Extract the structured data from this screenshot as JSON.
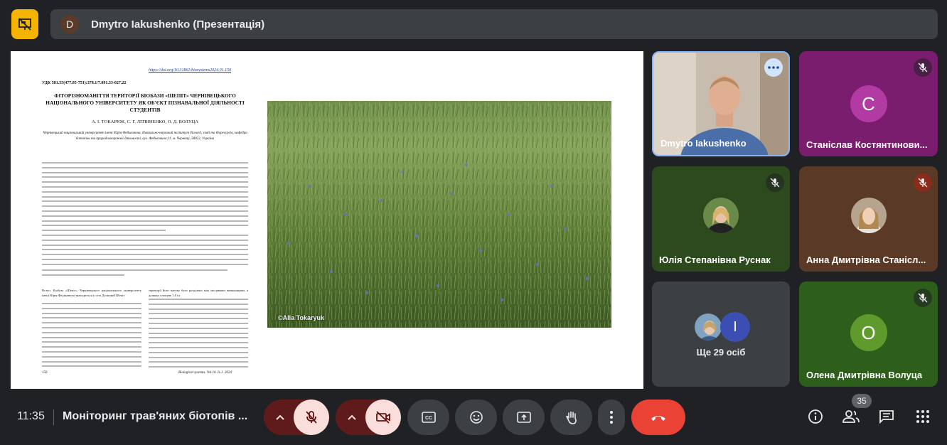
{
  "presenter": {
    "avatar_letter": "D",
    "title": "Dmytro Iakushenko (Презентація)"
  },
  "slide": {
    "doi": "https://doi.org/10.31861/biosystems2024.01.150",
    "udk": "УДК 581.55(477.85-751):378.1/7.091.33-027.22",
    "heading": "ФІТОРІЗНОМАНІТТЯ ТЕРИТОРІЇ БІОБАЗИ «ШЕПІТ» ЧЕРНІВЕЦЬКОГО НАЦІОНАЛЬНОГО УНІВЕРСИТЕТУ ЯК ОБ'ЄКТ ПІЗНАВАЛЬНОЇ ДІЯЛЬНОСТІ СТУДЕНТІВ",
    "authors": "А. І. ТОКАРЮК, С. Г. ЛІТВІНЕНКО, О. Д. ВОЛУЦА",
    "affiliation": "Чернівецький національний університет імені Юрія Федьковича, Навчально-науковий інститут біології, хімії та біоресурсів, кафедра ботаніки та природоохоронної діяльності, вул. Федьковича,11, м. Чернівці, 58022, Україна",
    "col1_start": "Вступ. Біобаза «Шепіт» Чернівецького національного університету імені Юрія Федьковича знаходиться у селі Долішній Шепіт",
    "col2_start": "території його маєтку було розділено між місцевими мешканцями, а ділянку площею 1,0 га",
    "footer_page": "150",
    "footer_journal": "Biological systems. Vol.16. Is.1. 2024",
    "photo_credit": "©Alla Tokaryuk"
  },
  "participants": [
    {
      "name": "Dmytro Iakushenko",
      "type": "video"
    },
    {
      "name": "Станіслав Костянтинови...",
      "letter": "C",
      "bg": "#7b1d6e",
      "avatar_color": "#b13aa3",
      "muted": true
    },
    {
      "name": "Юлія Степанівна Руснак",
      "bg": "#2d4a1e",
      "muted": true
    },
    {
      "name": "Анна Дмитрівна Станісл...",
      "bg": "#5a3a26",
      "muted": true
    },
    {
      "name": "Ще 29 осіб",
      "second_letter": "I",
      "avatar_color": "#3b4fb2"
    },
    {
      "name": "Олена Дмитрівна Волуца",
      "letter": "O",
      "bg": "#2e5e1c",
      "avatar_color": "#5f9a2c",
      "muted": true
    }
  ],
  "bottombar": {
    "time": "11:35",
    "meeting_title": "Моніторинг трав'яних біотопів ...",
    "people_count": "35"
  },
  "colors": {
    "accent_yellow": "#f4b400",
    "end_call": "#ea4335",
    "mic_off_bg": "#f9dedc"
  }
}
